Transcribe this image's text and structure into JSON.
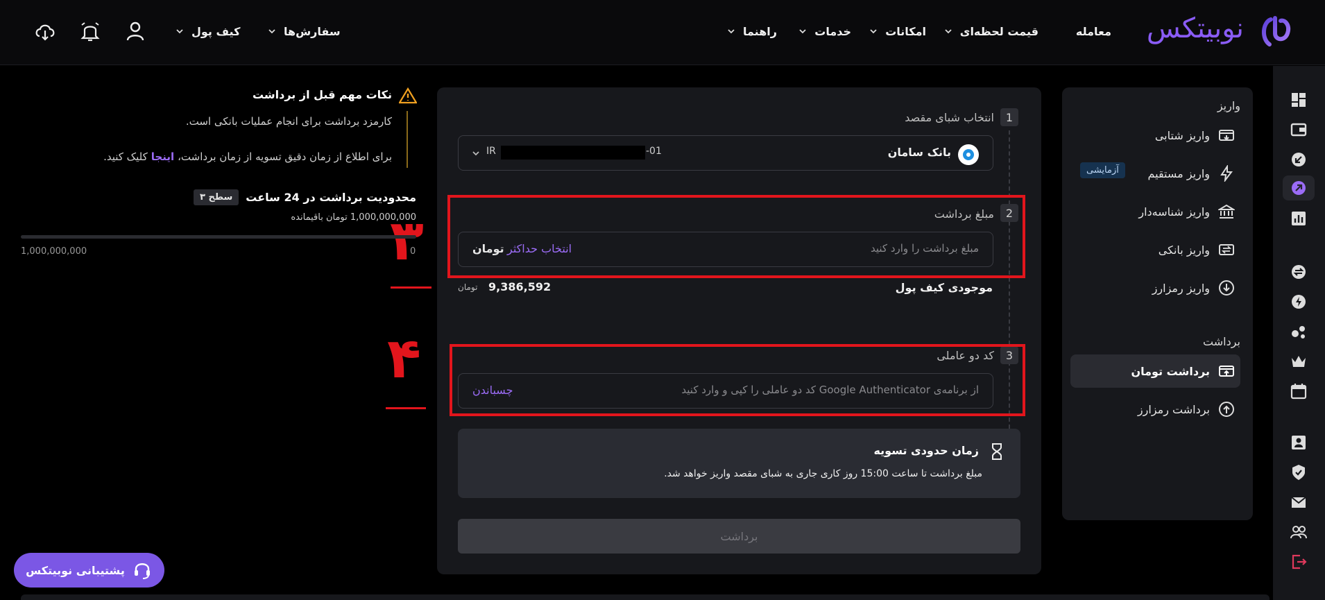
{
  "header": {
    "logo_text": "نوبیتکس",
    "nav": [
      "معامله",
      "قیمت لحظه‌ای",
      "امکانات",
      "خدمات",
      "راهنما"
    ],
    "user_nav": [
      "سفارش‌ها",
      "کیف پول"
    ]
  },
  "sidebar": {
    "deposit_title": "واریز",
    "deposit_items": [
      "واریز شتابی",
      "واریز مستقیم",
      "واریز شناسه‌دار",
      "واریز بانکی",
      "واریز رمزارز"
    ],
    "test_badge": "آزمایشی",
    "withdraw_title": "برداشت",
    "withdraw_items": [
      "برداشت تومان",
      "برداشت رمزارز"
    ]
  },
  "form": {
    "step1": {
      "num": "1",
      "label": "انتخاب شبای مقصد",
      "bank_name": "بانک سامان",
      "iban_prefix": "IR",
      "iban_suffix": "-01"
    },
    "step2": {
      "num": "2",
      "label": "مبلغ برداشت",
      "placeholder": "مبلغ برداشت را وارد کنید",
      "max_link": "انتخاب حداکثر",
      "unit": "تومان"
    },
    "wallet": {
      "label": "موجودی کیف پول",
      "value": "9,386,592",
      "unit": "تومان"
    },
    "step3": {
      "num": "3",
      "label": "کد دو عاملی",
      "placeholder": "از برنامه‌ی Google Authenticator کد دو عاملی را کپی و وارد کنید",
      "paste": "چسباندن"
    },
    "settlement": {
      "title": "زمان حدودی تسویه",
      "text": "مبلغ برداشت تا ساعت 15:00 روز کاری جاری به شبای مقصد واریز خواهد شد."
    },
    "submit": "برداشت"
  },
  "info": {
    "title": "نکات مهم قبل از برداشت",
    "line1": "کارمزد برداشت برای انجام عملیات بانکی است.",
    "line2_prefix": "برای اطلاع از زمان دقیق تسویه از زمان برداشت،",
    "line2_link": "اینجا",
    "line2_suffix": "کلیک کنید."
  },
  "limit": {
    "title": "محدودیت برداشت در 24 ساعت",
    "level": "سطح ۳",
    "remaining": "1,000,000,000 تومان باقیمانده",
    "progress": 0.0,
    "max": "1,000,000,000",
    "min": "0"
  },
  "annotations": {
    "n3": "۳",
    "n4": "۴"
  },
  "support": "پشتیبانی نوبیتکس",
  "colors": {
    "accent": "#8a5cf6",
    "annotation": "#e2151c",
    "bg": "#000000",
    "panel": "#17181c"
  }
}
